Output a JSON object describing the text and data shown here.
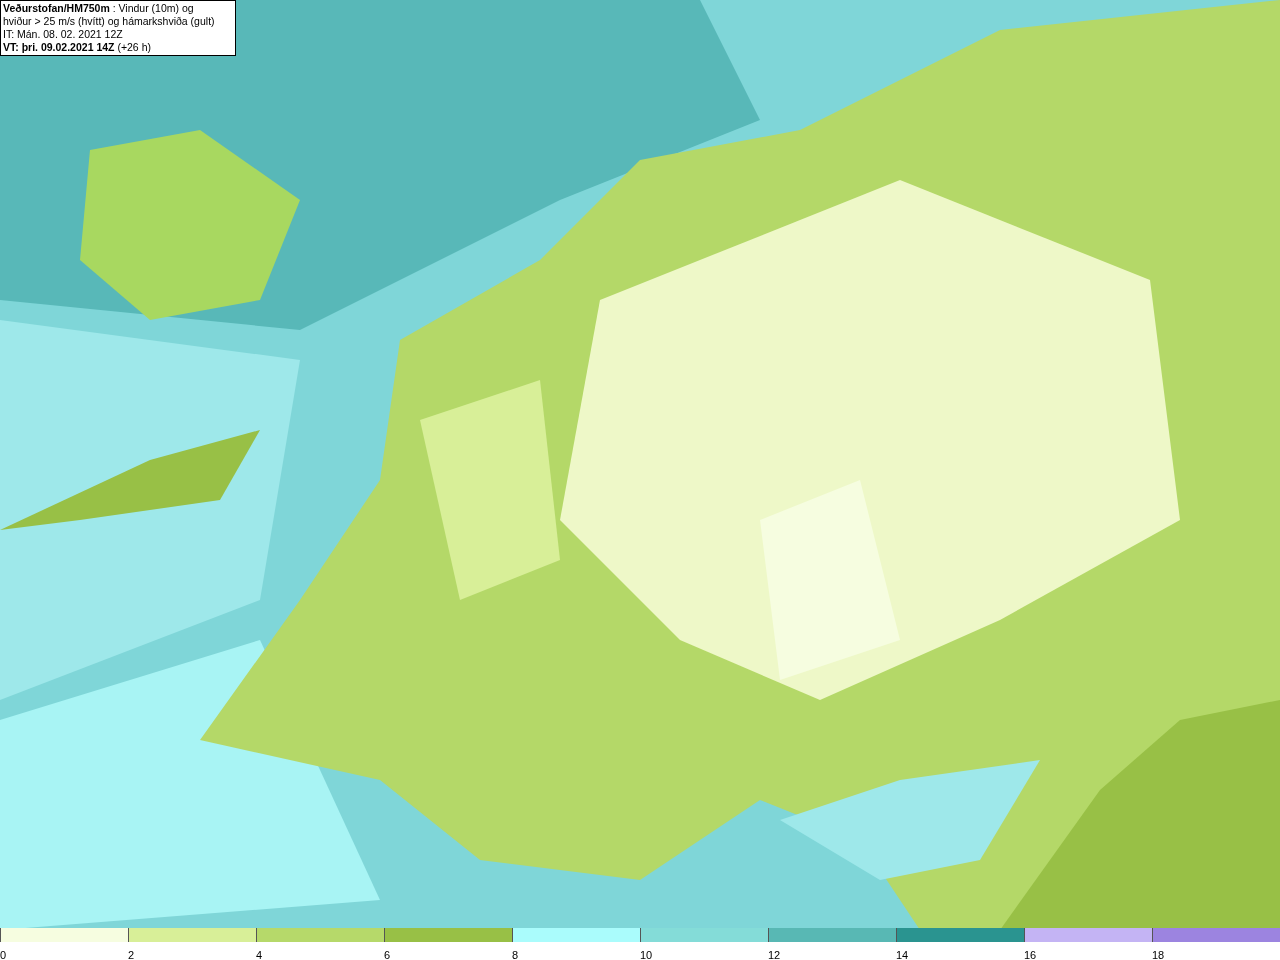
{
  "legend": {
    "lines": [
      "**Veðurstofan/HM750m** : Vindur (10m) og",
      "hviður > 25 m/s (hvítt) og hámarkshviða (gult)",
      "IT: Mán. 08. 02. 2021 12Z",
      "**VT: þri. 09.02.2021 14Z** (+26 h)"
    ]
  },
  "color_scale": {
    "segments": [
      {
        "color": "#f6fde0"
      },
      {
        "color": "#d8ef98"
      },
      {
        "color": "#b6d96a"
      },
      {
        "color": "#98c046"
      },
      {
        "color": "#aafcfc"
      },
      {
        "color": "#84dcd8"
      },
      {
        "color": "#58b8b4"
      },
      {
        "color": "#2a9490"
      },
      {
        "color": "#c4b4f4"
      },
      {
        "color": "#9c84e0"
      }
    ],
    "ticks": [
      "0",
      "2",
      "4",
      "6",
      "8",
      "10",
      "12",
      "14",
      "16",
      "18"
    ]
  }
}
